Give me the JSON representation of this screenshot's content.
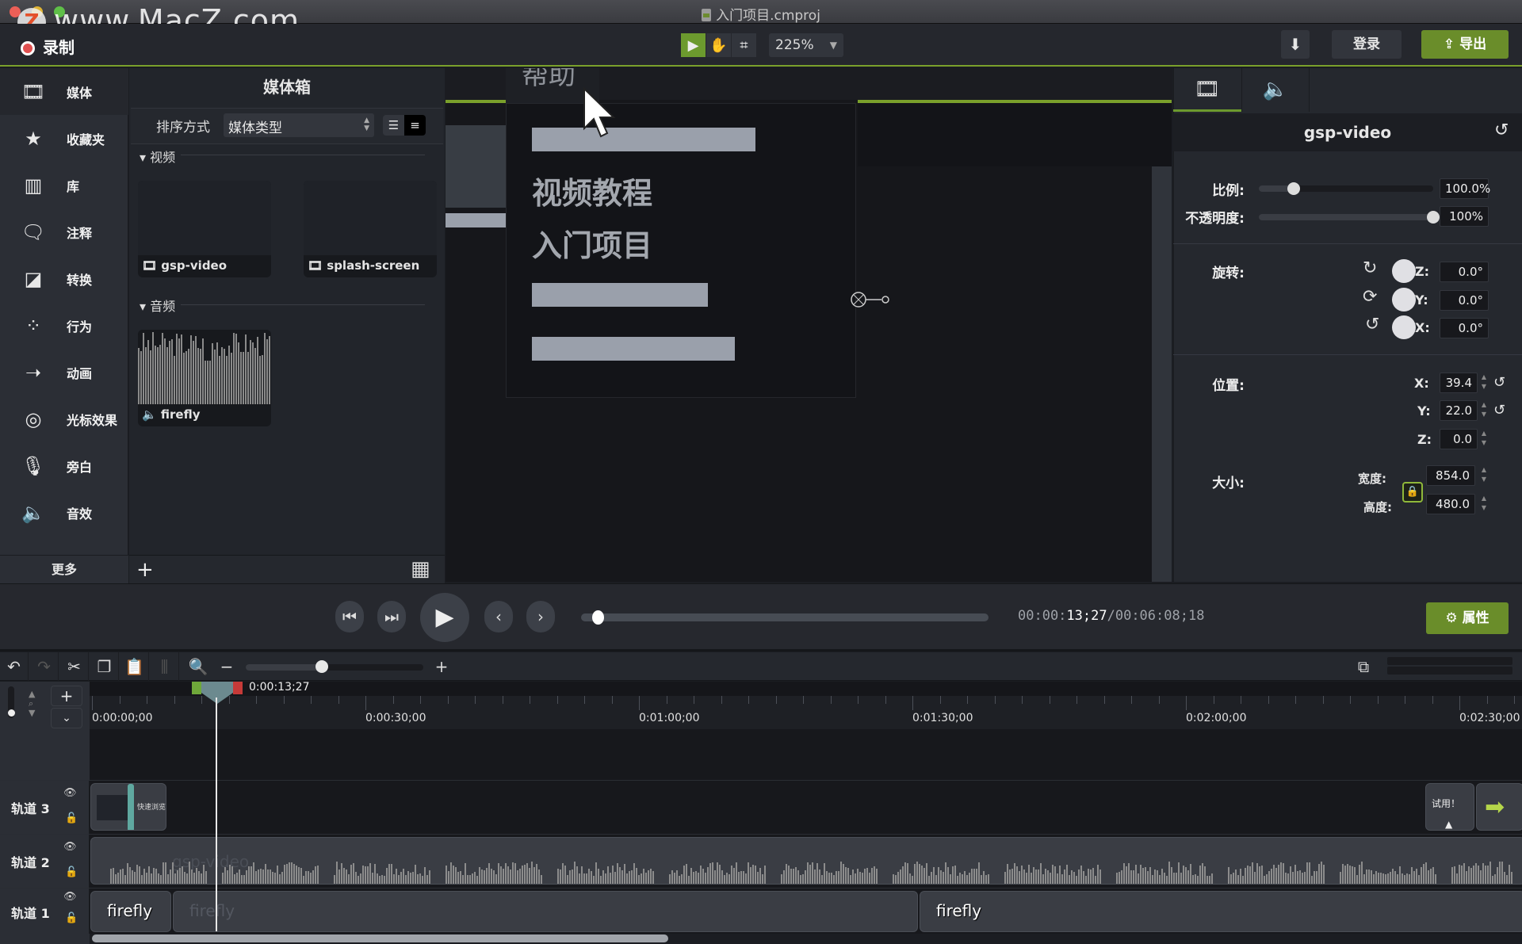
{
  "window": {
    "title": "入门项目.cmproj",
    "watermark": "www.MacZ.com",
    "watermark_logo": "Z"
  },
  "toolbar": {
    "record_label": "录制",
    "tools": [
      {
        "name": "select-tool",
        "icon": "▶",
        "active": true
      },
      {
        "name": "pan-tool",
        "icon": "✋",
        "active": false
      },
      {
        "name": "crop-tool",
        "icon": "⌗",
        "active": false
      }
    ],
    "zoom_value": "225%",
    "download_icon": "⬇",
    "login_label": "登录",
    "export_label": "导出"
  },
  "sidebar": {
    "items": [
      {
        "icon": "film-icon",
        "glyph": "🎞",
        "label": "媒体",
        "active": true
      },
      {
        "icon": "star-icon",
        "glyph": "★",
        "label": "收藏夹"
      },
      {
        "icon": "library-icon",
        "glyph": "▥",
        "label": "库"
      },
      {
        "icon": "annotation-icon",
        "glyph": "🗨",
        "label": "注释"
      },
      {
        "icon": "transition-icon",
        "glyph": "◪",
        "label": "转换"
      },
      {
        "icon": "behavior-icon",
        "glyph": "⁘",
        "label": "行为"
      },
      {
        "icon": "animation-icon",
        "glyph": "➝",
        "label": "动画"
      },
      {
        "icon": "cursor-effect-icon",
        "glyph": "◎",
        "label": "光标效果"
      },
      {
        "icon": "microphone-icon",
        "glyph": "🎙",
        "label": "旁白"
      },
      {
        "icon": "audio-effect-icon",
        "glyph": "🔈",
        "label": "音效"
      }
    ],
    "more_label": "更多"
  },
  "media_bin": {
    "title": "媒体箱",
    "sort_label": "排序方式",
    "sort_value": "媒体类型",
    "video_section": "视频",
    "audio_section": "音频",
    "videos": [
      {
        "name": "gsp-video"
      },
      {
        "name": "splash-screen"
      }
    ],
    "audios": [
      {
        "name": "firefly"
      }
    ],
    "add_icon": "+",
    "grid_icon": "▦"
  },
  "canvas": {
    "help_tab": "帮助",
    "help_items": [
      "视频教程",
      "入门项目"
    ]
  },
  "properties": {
    "clip_name": "gsp-video",
    "scale_label": "比例:",
    "scale_value": "100.0%",
    "scale_fraction": 0.2,
    "opacity_label": "不透明度:",
    "opacity_value": "100%",
    "opacity_fraction": 1.0,
    "rotation_label": "旋转:",
    "rotation": [
      {
        "axis": "Z:",
        "value": "0.0°"
      },
      {
        "axis": "Y:",
        "value": "0.0°"
      },
      {
        "axis": "X:",
        "value": "0.0°"
      }
    ],
    "position_label": "位置:",
    "position": [
      {
        "axis": "X:",
        "value": "39.4"
      },
      {
        "axis": "Y:",
        "value": "22.0"
      },
      {
        "axis": "Z:",
        "value": "0.0"
      }
    ],
    "size_label": "大小:",
    "width_label": "宽度:",
    "width_value": "854.0",
    "height_label": "高度:",
    "height_value": "480.0"
  },
  "transport": {
    "timecode_prefix": "00:00:",
    "timecode_current": "13;27",
    "timecode_total": "/00:06:08;18",
    "progress_fraction": 0.04,
    "properties_label": "属性"
  },
  "timeline": {
    "playhead_time": "0:00:13;27",
    "zoom_fraction": 0.43,
    "ruler_labels": [
      "0:00:00;00",
      "0:00:30;00",
      "0:01:00;00",
      "0:01:30;00",
      "0:02:00;00",
      "0:02:30;00"
    ],
    "tracks": [
      {
        "name": "轨道 3",
        "clips": [
          {
            "label": "快速浏览"
          },
          {
            "label": "试用！"
          }
        ]
      },
      {
        "name": "轨道 2",
        "clips": [
          {
            "label": "gsp-video"
          }
        ]
      },
      {
        "name": "轨道 1",
        "clips": [
          {
            "label": "firefly"
          },
          {
            "label": "firefly"
          },
          {
            "label": "firefly"
          }
        ]
      }
    ]
  },
  "colors": {
    "accent_green": "#6a8d2a",
    "record_red": "#e05050",
    "background": "#1b1d22"
  }
}
